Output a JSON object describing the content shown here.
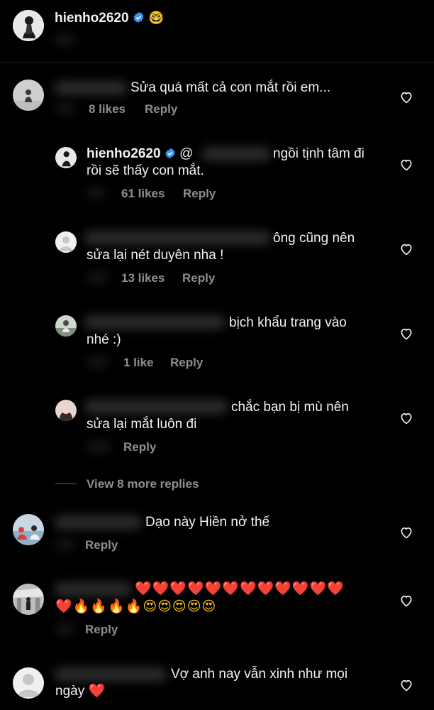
{
  "header": {
    "username": "hienho2620",
    "emoji": "🤓"
  },
  "comments": {
    "c1": {
      "text": "Sửa quá mất cả con mắt rồi em...",
      "likes": "8 likes",
      "reply": "Reply"
    },
    "r1": {
      "username": "hienho2620",
      "mention": "@",
      "text_line1": "ngồi tịnh tâm đi",
      "text_line2": "rồi sẽ thấy con mắt.",
      "likes": "61 likes",
      "reply": "Reply"
    },
    "r2": {
      "text_line1": "ông cũng nên",
      "text_line2": "sửa lại nét duyên nha !",
      "likes": "13 likes",
      "reply": "Reply"
    },
    "r3": {
      "text_line1": "bịch khẩu trang vào",
      "text_line2": "nhé :)",
      "likes": "1 like",
      "reply": "Reply"
    },
    "r4": {
      "text_line1": "chắc bạn bị mù nên",
      "text_line2": "sửa lại mắt luôn đi",
      "reply": "Reply"
    },
    "view_more": "View 8 more replies",
    "c2": {
      "text": "Dạo này Hiền nở thế",
      "reply": "Reply"
    },
    "c3": {
      "hearts_line1": "❤️❤️❤️❤️❤️❤️❤️❤️❤️❤️❤️❤️",
      "line2_heart": "❤️",
      "line2_fire": "🔥🔥🔥🔥",
      "line2_eyes": "😍😍😍😍😍",
      "reply": "Reply"
    },
    "c4": {
      "text_line1": "Vợ anh nay vẫn xinh như mọi",
      "text_line2": "ngày",
      "emoji": "❤️"
    }
  },
  "icons": {
    "like": "heart-outline-icon",
    "verified": "verified-badge-icon"
  },
  "colors": {
    "background": "#000000",
    "meta": "#8e8e8e",
    "verified": "#3897f0"
  }
}
